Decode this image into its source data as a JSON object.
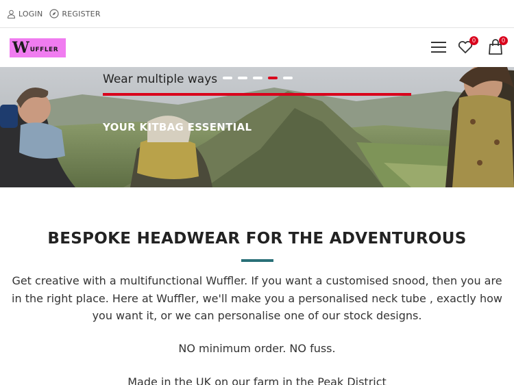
{
  "topbar": {
    "login_label": "LOGIN",
    "register_label": "REGISTER"
  },
  "header": {
    "logo_big": "W",
    "logo_rest": "UFFLER",
    "wishlist_count": "0",
    "cart_count": "0"
  },
  "hero": {
    "title": "Wear multiple ways",
    "subtitle": "YOUR KITBAG ESSENTIAL",
    "slides_total": 5,
    "active_slide": 4
  },
  "content": {
    "heading": "BESPOKE HEADWEAR FOR THE ADVENTUROUS",
    "paragraph": "Get creative with a multifunctional Wuffler. If you want a customised snood, then you are in the right place. Here at Wuffler, we'll make you a personalised neck tube , exactly how you want it, or we can personalise one of our stock designs.",
    "line2": "NO minimum order. NO fuss.",
    "line3": "Made in the UK on our farm in the Peak District"
  },
  "colors": {
    "accent_red": "#d9001b",
    "logo_pink": "#f07cf0",
    "divider_teal": "#2a7078"
  }
}
